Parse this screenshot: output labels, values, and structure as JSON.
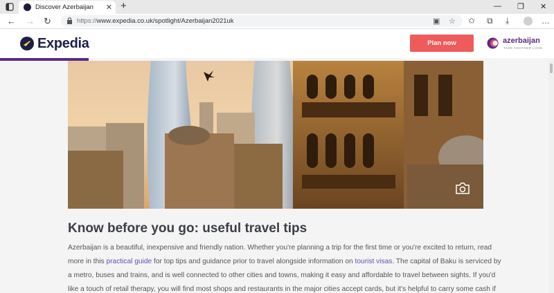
{
  "browser": {
    "tab_title": "Discover Azerbaijan",
    "url_prefix": "https://",
    "url": "www.expedia.co.uk/spotlight/Azerbaijan2021uk"
  },
  "site": {
    "logo_text": "Expedia",
    "plan_button": "Plan now",
    "partner_name": "azerbaijan",
    "partner_tagline": "TAKE ANOTHER LOOK",
    "brand_color": "#5a2a86",
    "cta_color": "#ef5a5a",
    "progress_fraction": 0.16
  },
  "article": {
    "headline": "Know before you go: useful travel tips",
    "line1": "Azerbaijan is a beautiful, inexpensive and friendly nation. Whether you're planning a trip for the first time or you're excited to return, read",
    "line2_a": "more in this ",
    "line2_link": "practical guide",
    "line2_b": " for top tips and guidance prior to travel alongside information on ",
    "line2_link2": "tourist visas",
    "line2_c": ". The capital of Baku is serviced by",
    "line3": "a metro, buses and trains, and is well connected to other cities and towns, making it easy and affordable to travel between sights. If you'd",
    "line4": "like a touch of retail therapy, you will find most shops and restaurants in the major cities accept cards, but it's helpful to carry some cash if"
  },
  "icons": [
    "tab-actions-icon",
    "new-tab-icon",
    "minimize-icon",
    "maximize-icon",
    "close-window-icon",
    "back-icon",
    "forward-icon",
    "refresh-icon",
    "lock-icon",
    "read-aloud-icon",
    "favorite-add-icon",
    "favorites-icon",
    "collections-icon",
    "downloads-icon",
    "profile-icon",
    "more-icon",
    "camera-icon"
  ]
}
